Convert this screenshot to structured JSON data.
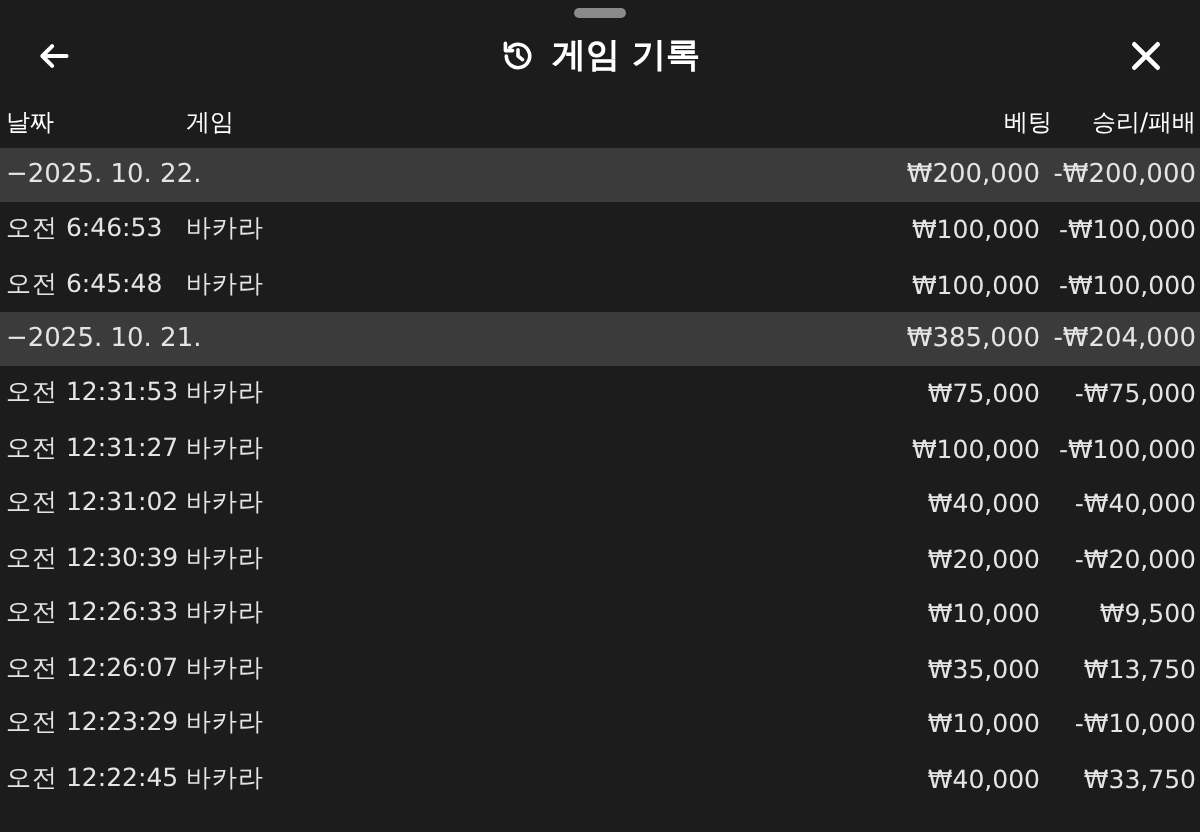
{
  "header": {
    "title": "게임 기록"
  },
  "columns": [
    "날짜",
    "게임",
    "베팅",
    "승리/패배"
  ],
  "groups": [
    {
      "date": "−2025. 10. 22.",
      "bet": "₩200,000",
      "result": "-₩200,000",
      "rows": [
        {
          "time": "오전 6:46:53",
          "game": "바카라",
          "bet": "₩100,000",
          "result": "-₩100,000"
        },
        {
          "time": "오전 6:45:48",
          "game": "바카라",
          "bet": "₩100,000",
          "result": "-₩100,000"
        }
      ]
    },
    {
      "date": "−2025. 10. 21.",
      "bet": "₩385,000",
      "result": "-₩204,000",
      "rows": [
        {
          "time": "오전 12:31:53",
          "game": "바카라",
          "bet": "₩75,000",
          "result": "-₩75,000"
        },
        {
          "time": "오전 12:31:27",
          "game": "바카라",
          "bet": "₩100,000",
          "result": "-₩100,000"
        },
        {
          "time": "오전 12:31:02",
          "game": "바카라",
          "bet": "₩40,000",
          "result": "-₩40,000"
        },
        {
          "time": "오전 12:30:39",
          "game": "바카라",
          "bet": "₩20,000",
          "result": "-₩20,000"
        },
        {
          "time": "오전 12:26:33",
          "game": "바카라",
          "bet": "₩10,000",
          "result": "₩9,500"
        },
        {
          "time": "오전 12:26:07",
          "game": "바카라",
          "bet": "₩35,000",
          "result": "₩13,750"
        },
        {
          "time": "오전 12:23:29",
          "game": "바카라",
          "bet": "₩10,000",
          "result": "-₩10,000"
        },
        {
          "time": "오전 12:22:45",
          "game": "바카라",
          "bet": "₩40,000",
          "result": "₩33,750"
        }
      ]
    }
  ]
}
